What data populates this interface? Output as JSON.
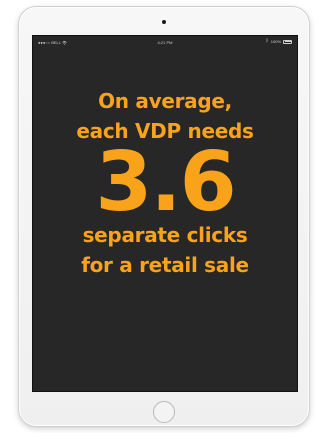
{
  "status_bar": {
    "carrier": "●●●○○ BELL",
    "time": "4:21 PM",
    "battery_percent": "100%"
  },
  "message": {
    "line1": "On average,",
    "line2": "each VDP needs",
    "number": "3.6",
    "line3": "separate clicks",
    "line4": "for a retail sale"
  },
  "colors": {
    "screen_background": "#272727",
    "accent_text": "#f9a31b",
    "device_frame": "#efefef"
  }
}
